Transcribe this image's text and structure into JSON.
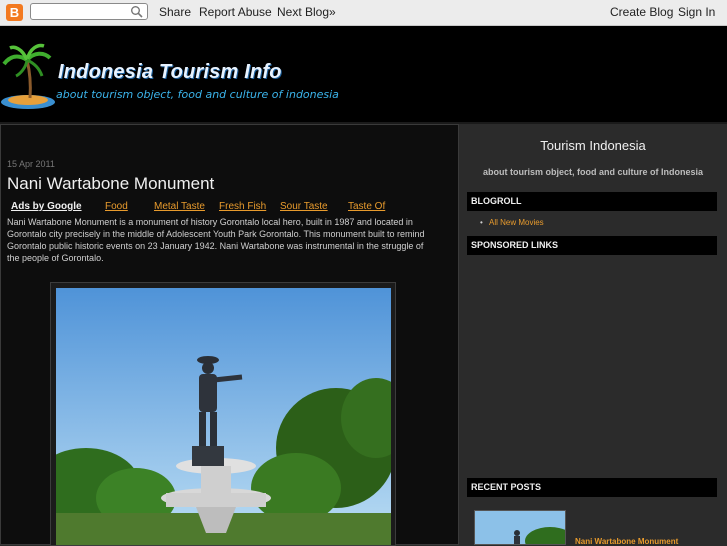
{
  "navbar": {
    "logo_letter": "B",
    "search_placeholder": "",
    "links": {
      "share": "Share",
      "report_abuse": "Report Abuse",
      "next_blog": "Next Blog»",
      "create_blog": "Create Blog",
      "sign_in": "Sign In"
    }
  },
  "header": {
    "title": "Indonesia Tourism Info",
    "tagline": "about tourism object, food and culture of indonesia"
  },
  "post": {
    "date": "15 Apr 2011",
    "title": "Nani Wartabone Monument",
    "ads_label": "Ads by Google",
    "ad_links": [
      "Food",
      "Metal Taste",
      "Fresh Fish",
      "Sour Taste",
      "Taste Of"
    ],
    "body": "Nani Wartabone Monument is a monument of history Gorontalo local hero, built in 1987 and located in Gorontalo city precisely in the middle of Adolescent Youth Park Gorontalo. This monument built to remind Gorontalo public historic events on 23 January 1942. Nani Wartabone was instrumental in the struggle of the people of Gorontalo."
  },
  "sidebar": {
    "title": "Tourism Indonesia",
    "description": "about tourism object, food and culture of Indonesia",
    "blogroll_heading": "BLOGROLL",
    "blogroll_items": [
      "All New Movies"
    ],
    "sponsored_heading": "SPONSORED LINKS",
    "recent_heading": "RECENT POSTS",
    "recent_posts": [
      "Nani Wartabone Monument"
    ]
  },
  "colors": {
    "link": "#e89b2d",
    "tagline": "#3bb3ea",
    "background": "#2b2b2b"
  }
}
